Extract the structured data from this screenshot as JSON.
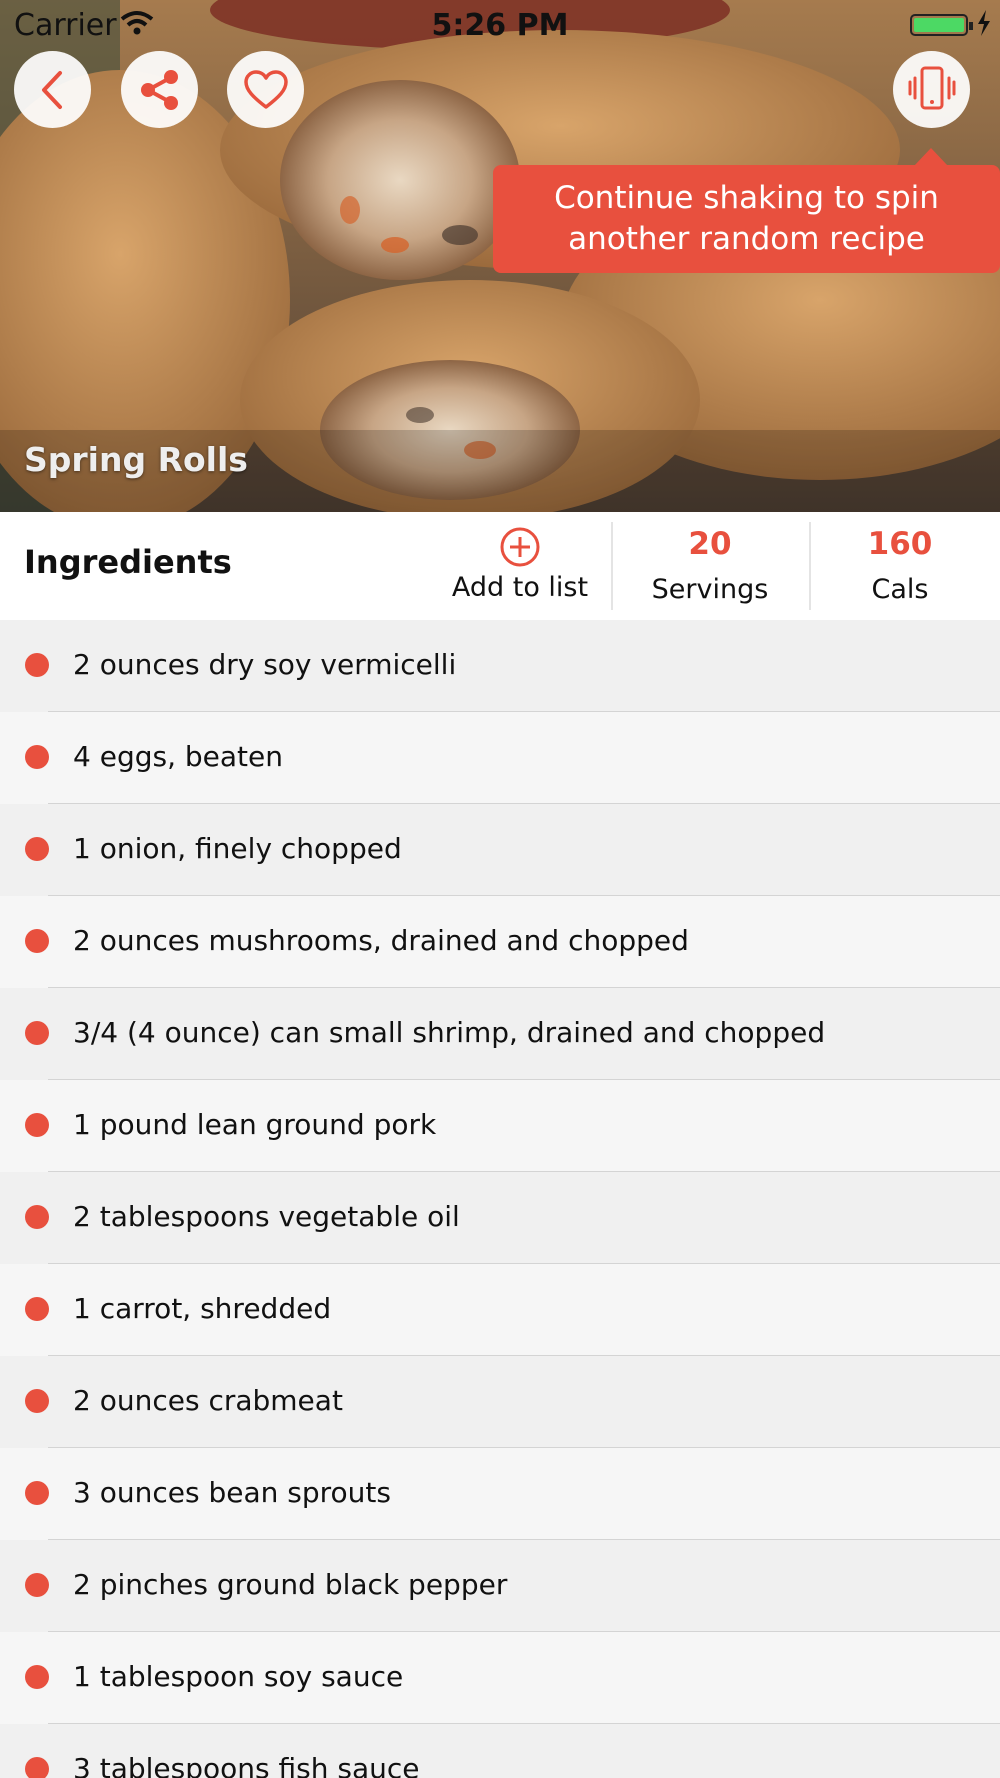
{
  "status_bar": {
    "carrier": "Carrier",
    "time": "5:26 PM",
    "battery_color": "#4cd964"
  },
  "hero": {
    "recipe_title": "Spring Rolls",
    "buttons": [
      {
        "icon": "chevron-left-icon",
        "label": "back"
      },
      {
        "icon": "share-icon",
        "label": "share"
      },
      {
        "icon": "heart-icon",
        "label": "favorite"
      },
      {
        "icon": "shake-phone-icon",
        "label": "shake"
      }
    ],
    "tooltip": "Continue shaking to spin another random recipe"
  },
  "summary": {
    "heading": "Ingredients",
    "add_to_list": "Add to list",
    "servings_value": "20",
    "servings_label": "Servings",
    "cals_value": "160",
    "cals_label": "Cals"
  },
  "ingredients": [
    "2 ounces dry soy vermicelli",
    "4 eggs, beaten",
    "1 onion, finely chopped",
    "2 ounces mushrooms, drained and chopped",
    "3/4 (4 ounce) can small shrimp, drained and chopped",
    "1 pound lean ground pork",
    "2 tablespoons vegetable oil",
    "1 carrot, shredded",
    "2 ounces crabmeat",
    "3 ounces bean sprouts",
    "2 pinches ground black pepper",
    "1 tablespoon soy sauce",
    "3 tablespoons fish sauce"
  ],
  "colors": {
    "accent": "#e8503e",
    "row_odd": "#f0f0f0",
    "row_even": "#f6f6f6"
  }
}
